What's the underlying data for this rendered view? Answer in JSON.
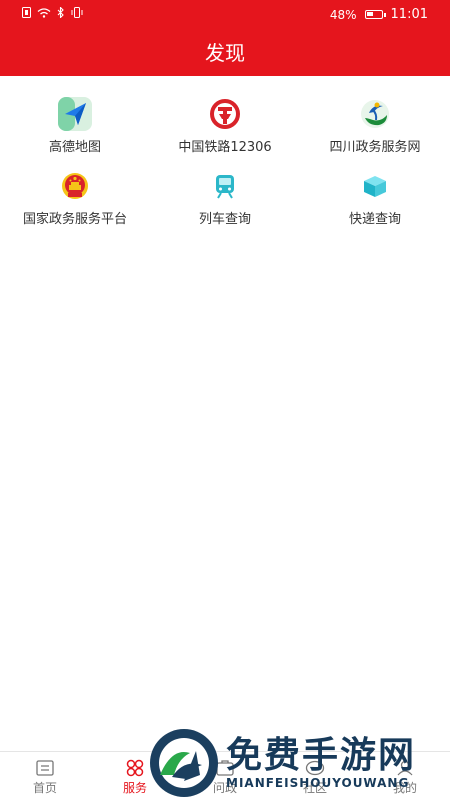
{
  "status_bar": {
    "battery": "48%",
    "battery_level": 0.48,
    "time": "11:01"
  },
  "title": "发现",
  "services": [
    {
      "label": "高德地图",
      "icon": "amap-icon"
    },
    {
      "label": "中国铁路12306",
      "icon": "railway-icon"
    },
    {
      "label": "四川政务服务网",
      "icon": "sichuan-gov-icon"
    },
    {
      "label": "国家政务服务平台",
      "icon": "national-emblem-icon"
    },
    {
      "label": "列车查询",
      "icon": "train-icon"
    },
    {
      "label": "快递查询",
      "icon": "package-icon"
    }
  ],
  "tabs": [
    {
      "label": "首页",
      "icon": "home-icon"
    },
    {
      "label": "服务",
      "icon": "service-icon",
      "active": true
    },
    {
      "label": "问政",
      "icon": "inquiry-icon"
    },
    {
      "label": "社区",
      "icon": "community-icon"
    },
    {
      "label": "我的",
      "icon": "profile-icon"
    }
  ],
  "watermark": {
    "cn": "免费手游网",
    "en": "MIANFEISHOUYOUWANG"
  },
  "colors": {
    "primary": "#e5151d",
    "text": "#333333",
    "tab_inactive": "#777777"
  }
}
